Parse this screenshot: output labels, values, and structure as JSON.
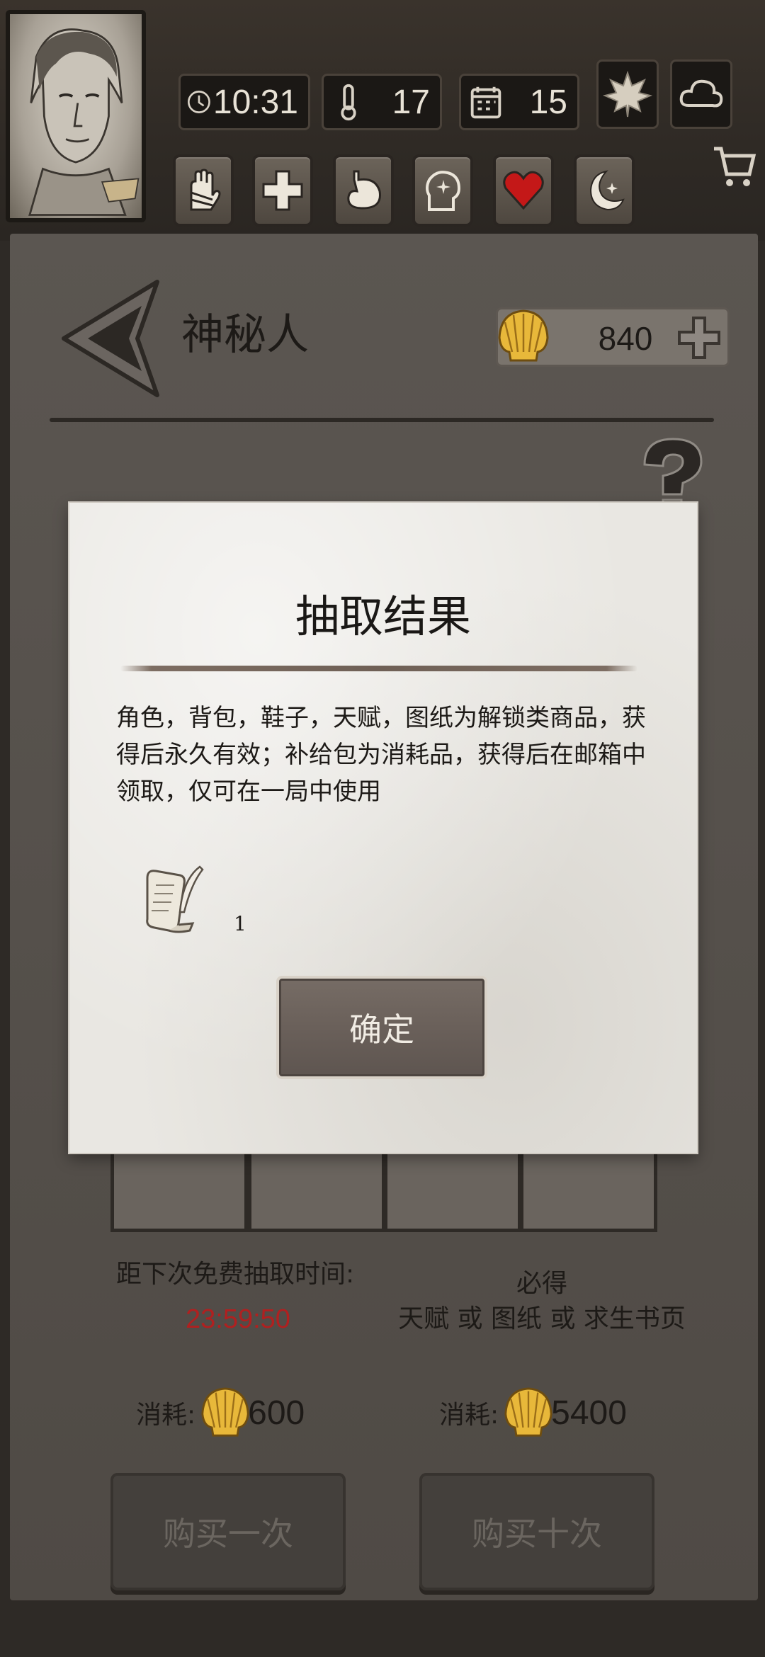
{
  "hud": {
    "time": "10:31",
    "temperature": "17",
    "day": "15"
  },
  "shop": {
    "title": "神秘人",
    "currency_amount": "840"
  },
  "draw": {
    "free_label": "距下次免费抽取时间:",
    "free_timer": "23:59:50",
    "guarantee_line1": "必得",
    "guarantee_line2": "天赋 或 图纸 或 求生书页",
    "cost_label": "消耗:",
    "cost_single": "600",
    "cost_ten": "5400",
    "buy_once": "购买一次",
    "buy_ten": "购买十次"
  },
  "dialog": {
    "title": "抽取结果",
    "description": "角色，背包，鞋子，天赋，图纸为解锁类商品，获得后永久有效；补给包为消耗品，获得后在邮箱中领取，仅可在一局中使用",
    "reward_icon": "scroll-quill-icon",
    "reward_count": "1",
    "confirm_label": "确定"
  },
  "colors": {
    "timer_red": "#b02020",
    "panel": "#555049",
    "dialog_paper": "#e9e7e2"
  }
}
